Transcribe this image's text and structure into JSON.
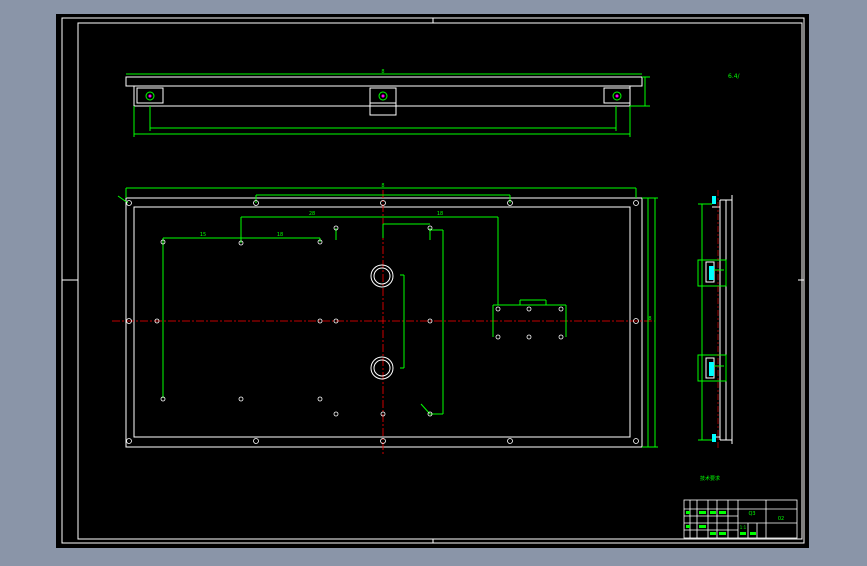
{
  "colors": {
    "window_bg": "#8a95a8",
    "sheet": "#000000",
    "border": "#ffffff",
    "geometry": "#ffffff",
    "dimension": "#00ff00",
    "centerline": "#ff0000",
    "hole": "#ff00ff",
    "note": "#00ff00"
  },
  "drawing": {
    "views": [
      "top-view",
      "front-view",
      "side-view"
    ],
    "labels": {
      "top_overall_dim": "8",
      "front_overall_dim": "8",
      "front_inner_dim_1": "28",
      "front_inner_dim_2": "18",
      "front_left_dim": "15",
      "front_mid_dim": "18",
      "front_right_dim": "8",
      "roughness_note": "6.4/",
      "technical_note": "技术要求"
    },
    "title_block": {
      "material": "Q3",
      "scale": "1:1",
      "drawing_no": "02"
    }
  }
}
